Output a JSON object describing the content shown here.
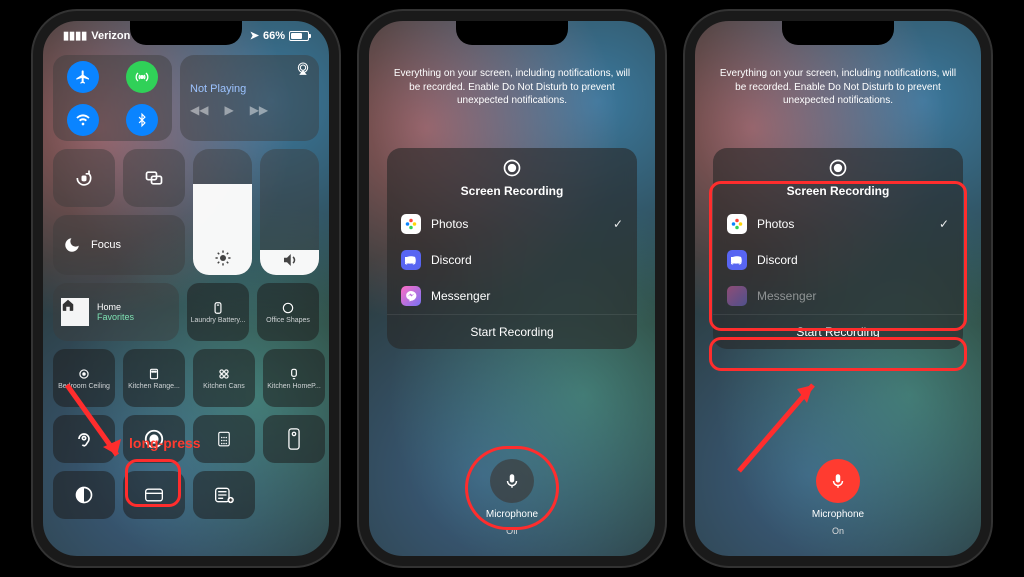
{
  "status": {
    "carrier": "Verizon",
    "battery_pct": "66%",
    "location_icon": "location-arrow"
  },
  "annotation": {
    "long_press": "long-press"
  },
  "cc": {
    "music": {
      "title": "Not Playing"
    },
    "focus": "Focus",
    "home": {
      "title": "Home",
      "sub": "Favorites"
    },
    "shortcuts": [
      {
        "label": "Laundry Battery..."
      },
      {
        "label": "Office Shapes"
      },
      {
        "label": "Bedroom Ceiling"
      },
      {
        "label": "Kitchen Range..."
      },
      {
        "label": "Kitchen Cans"
      },
      {
        "label": "Kitchen HomeP..."
      }
    ]
  },
  "sr": {
    "hint": "Everything on your screen, including notifications, will be recorded. Enable Do Not Disturb to prevent unexpected notifications.",
    "title": "Screen Recording",
    "apps": [
      {
        "name": "Photos",
        "icon": "photos",
        "selected": true
      },
      {
        "name": "Discord",
        "icon": "discord",
        "selected": false
      },
      {
        "name": "Messenger",
        "icon": "messenger",
        "selected": false
      }
    ],
    "start": "Start Recording",
    "mic_label": "Microphone",
    "mic_off": "Off",
    "mic_on": "On"
  },
  "colors": {
    "photos": "#fff",
    "discord": "#5865F2",
    "messenger": "#e73ccf"
  }
}
